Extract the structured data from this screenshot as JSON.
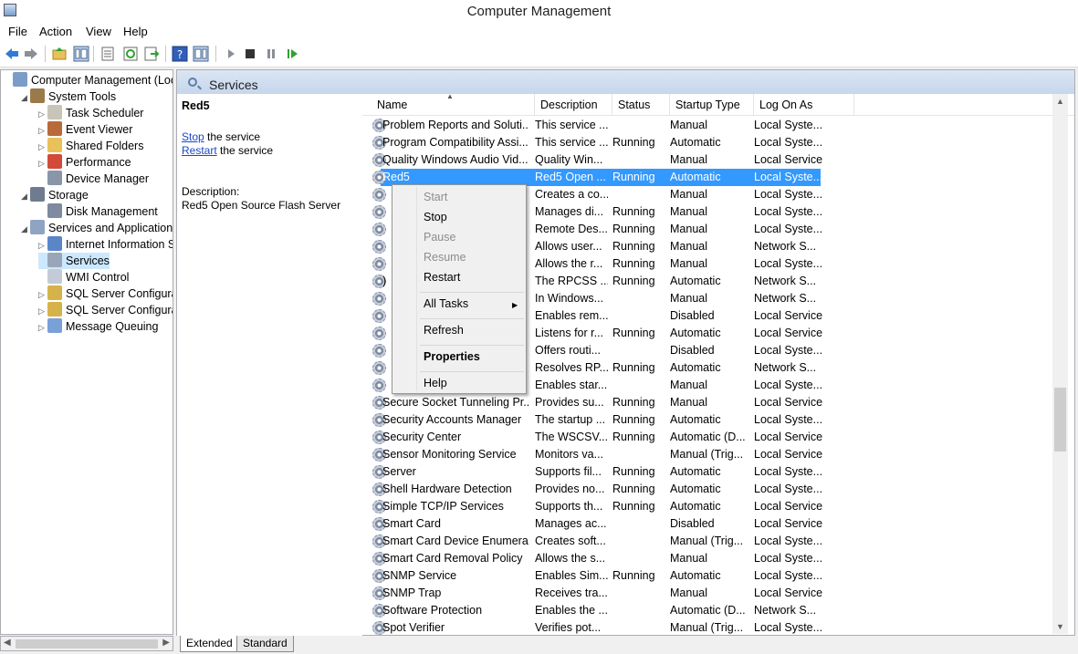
{
  "window": {
    "title": "Computer Management"
  },
  "menu": [
    "File",
    "Action",
    "View",
    "Help"
  ],
  "toolbar_icons": [
    "back-arrow-icon",
    "forward-arrow-icon",
    "up-folder-icon",
    "show-hide-tree-icon",
    "export-list-icon",
    "refresh-icon",
    "export-icon",
    "help-icon",
    "show-hide-action-pane-icon",
    "play-icon",
    "stop-icon",
    "pause-icon",
    "resume-icon"
  ],
  "tree": [
    {
      "label": "Computer Management (Local",
      "level": 0,
      "exp": "",
      "icon": "computer"
    },
    {
      "label": "System Tools",
      "level": 1,
      "exp": "◢",
      "icon": "tools"
    },
    {
      "label": "Task Scheduler",
      "level": 2,
      "exp": "▷",
      "icon": "clock"
    },
    {
      "label": "Event Viewer",
      "level": 2,
      "exp": "▷",
      "icon": "event"
    },
    {
      "label": "Shared Folders",
      "level": 2,
      "exp": "▷",
      "icon": "folder"
    },
    {
      "label": "Performance",
      "level": 2,
      "exp": "▷",
      "icon": "perf"
    },
    {
      "label": "Device Manager",
      "level": 2,
      "exp": "",
      "icon": "device"
    },
    {
      "label": "Storage",
      "level": 1,
      "exp": "◢",
      "icon": "storage"
    },
    {
      "label": "Disk Management",
      "level": 2,
      "exp": "",
      "icon": "disk"
    },
    {
      "label": "Services and Applications",
      "level": 1,
      "exp": "◢",
      "icon": "apps"
    },
    {
      "label": "Internet Information Ser",
      "level": 2,
      "exp": "▷",
      "icon": "iis"
    },
    {
      "label": "Services",
      "level": 2,
      "exp": "",
      "icon": "gear",
      "selected": true
    },
    {
      "label": "WMI Control",
      "level": 2,
      "exp": "",
      "icon": "wmi"
    },
    {
      "label": "SQL Server Configuratic",
      "level": 2,
      "exp": "▷",
      "icon": "sql"
    },
    {
      "label": "SQL Server Configuratic",
      "level": 2,
      "exp": "▷",
      "icon": "sql"
    },
    {
      "label": "Message Queuing",
      "level": 2,
      "exp": "▷",
      "icon": "mq"
    }
  ],
  "pane": {
    "header": "Services",
    "selected_service": "Red5",
    "stop_link": "Stop",
    "stop_rest": " the service",
    "restart_link": "Restart",
    "restart_rest": " the service",
    "description_label": "Description:",
    "description": "Red5 Open Source Flash Server"
  },
  "columns": [
    "Name",
    "Description",
    "Status",
    "Startup Type",
    "Log On As"
  ],
  "rows": [
    [
      "Problem Reports and Soluti...",
      "This service ...",
      "",
      "Manual",
      "Local Syste..."
    ],
    [
      "Program Compatibility Assi...",
      "This service ...",
      "Running",
      "Automatic",
      "Local Syste..."
    ],
    [
      "Quality Windows Audio Vid...",
      "Quality Win...",
      "",
      "Manual",
      "Local Service"
    ],
    [
      "Red5",
      "Red5 Open ...",
      "Running",
      "Automatic",
      "Local Syste..."
    ],
    [
      "",
      "Creates a co...",
      "",
      "Manual",
      "Local Syste..."
    ],
    [
      "",
      "Manages di...",
      "Running",
      "Manual",
      "Local Syste..."
    ],
    [
      "",
      "Remote Des...",
      "Running",
      "Manual",
      "Local Syste..."
    ],
    [
      "",
      "Allows user...",
      "Running",
      "Manual",
      "Network S..."
    ],
    [
      "",
      "Allows the r...",
      "Running",
      "Manual",
      "Local Syste..."
    ],
    [
      ")",
      "The RPCSS ...",
      "Running",
      "Automatic",
      "Network S..."
    ],
    [
      "",
      "In Windows...",
      "",
      "Manual",
      "Network S..."
    ],
    [
      "",
      "Enables rem...",
      "",
      "Disabled",
      "Local Service"
    ],
    [
      "",
      "Listens for r...",
      "Running",
      "Automatic",
      "Local Service"
    ],
    [
      "",
      "Offers routi...",
      "",
      "Disabled",
      "Local Syste..."
    ],
    [
      "",
      "Resolves RP...",
      "Running",
      "Automatic",
      "Network S..."
    ],
    [
      "",
      "Enables star...",
      "",
      "Manual",
      "Local Syste..."
    ],
    [
      "Secure Socket Tunneling Pr...",
      "Provides su...",
      "Running",
      "Manual",
      "Local Service"
    ],
    [
      "Security Accounts Manager",
      "The startup ...",
      "Running",
      "Automatic",
      "Local Syste..."
    ],
    [
      "Security Center",
      "The WSCSV...",
      "Running",
      "Automatic (D...",
      "Local Service"
    ],
    [
      "Sensor Monitoring Service",
      "Monitors va...",
      "",
      "Manual (Trig...",
      "Local Service"
    ],
    [
      "Server",
      "Supports fil...",
      "Running",
      "Automatic",
      "Local Syste..."
    ],
    [
      "Shell Hardware Detection",
      "Provides no...",
      "Running",
      "Automatic",
      "Local Syste..."
    ],
    [
      "Simple TCP/IP Services",
      "Supports th...",
      "Running",
      "Automatic",
      "Local Service"
    ],
    [
      "Smart Card",
      "Manages ac...",
      "",
      "Disabled",
      "Local Service"
    ],
    [
      "Smart Card Device Enumera...",
      "Creates soft...",
      "",
      "Manual (Trig...",
      "Local Syste..."
    ],
    [
      "Smart Card Removal Policy",
      "Allows the s...",
      "",
      "Manual",
      "Local Syste..."
    ],
    [
      "SNMP Service",
      "Enables Sim...",
      "Running",
      "Automatic",
      "Local Syste..."
    ],
    [
      "SNMP Trap",
      "Receives tra...",
      "",
      "Manual",
      "Local Service"
    ],
    [
      "Software Protection",
      "Enables the ...",
      "",
      "Automatic (D...",
      "Network S..."
    ],
    [
      "Spot Verifier",
      "Verifies pot...",
      "",
      "Manual (Trig...",
      "Local Syste..."
    ]
  ],
  "selected_row": 3,
  "context_menu": {
    "items": [
      {
        "label": "Start",
        "disabled": true
      },
      {
        "label": "Stop"
      },
      {
        "label": "Pause",
        "disabled": true
      },
      {
        "label": "Resume",
        "disabled": true
      },
      {
        "label": "Restart"
      },
      {
        "sep": true
      },
      {
        "label": "All Tasks",
        "submenu": true
      },
      {
        "sep": true
      },
      {
        "label": "Refresh"
      },
      {
        "sep": true
      },
      {
        "label": "Properties",
        "bold": true
      },
      {
        "sep": true
      },
      {
        "label": "Help"
      }
    ]
  },
  "tabs": [
    "Extended",
    "Standard"
  ],
  "colors": {
    "selection": "#3399ff",
    "header_gradient_top": "#dbe6f4",
    "link": "#1a49c0"
  }
}
